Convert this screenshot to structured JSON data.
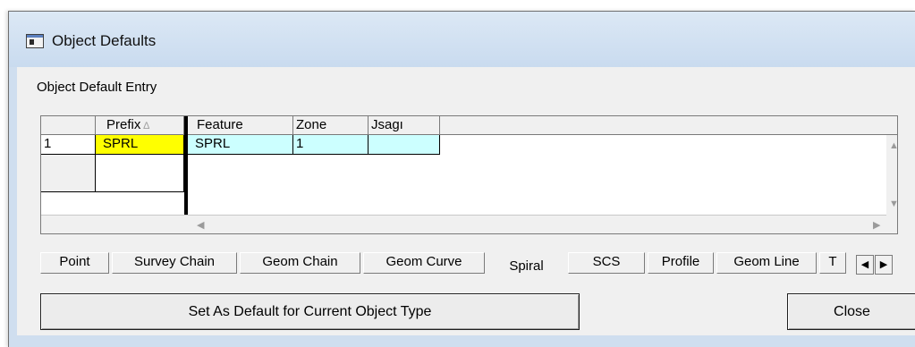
{
  "window": {
    "title": "Object Defaults"
  },
  "entry_label": "Object Default Entry",
  "grid": {
    "headers": {
      "row": "",
      "prefix": "Prefix",
      "feature": "Feature",
      "zone": "Zone",
      "usage": "Jsagı"
    },
    "sort_indicator": "∆",
    "rows": [
      {
        "row": "1",
        "prefix": "SPRL",
        "feature": "SPRL",
        "zone": "1",
        "usage": ""
      },
      {
        "row": "",
        "prefix": "",
        "feature": "",
        "zone": "",
        "usage": ""
      }
    ],
    "scroll_glyphs": {
      "left": "◀",
      "right": "▶",
      "up": "▲",
      "down": "▼"
    }
  },
  "tabs": [
    "Point",
    "Survey Chain",
    "Geom Chain",
    "Geom Curve",
    "Spiral",
    "SCS",
    "Profile",
    "Geom Line",
    "T"
  ],
  "active_tab": "Spiral",
  "tab_scroll": {
    "left": "◀",
    "right": "▶"
  },
  "buttons": {
    "set_default": "Set As Default for Current Object Type",
    "close": "Close"
  },
  "colors": {
    "prefix_cell": "#ffff00",
    "data_cells": "#ccffff"
  }
}
